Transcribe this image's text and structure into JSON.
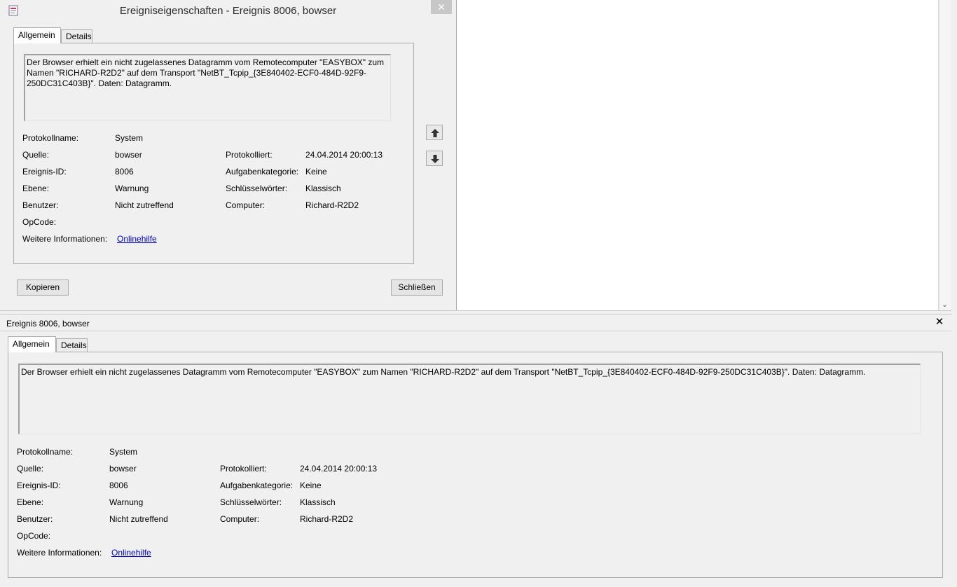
{
  "dialog": {
    "title": "Ereigniseigenschaften - Ereignis 8006, bowser",
    "close_glyph": "✕",
    "tabs": [
      "Allgemein",
      "Details"
    ],
    "message": "Der Browser erhielt ein nicht zugelassenes Datagramm vom Remotecomputer \"EASYBOX\" zum Namen \"RICHARD-R2D2\" auf dem Transport \"NetBT_Tcpip_{3E840402-ECF0-484D-92F9-250DC31C403B}\". Daten: Datagramm.",
    "buttons": {
      "copy": "Kopieren",
      "close": "Schließen"
    },
    "nav_icons": [
      "arrow-up-icon",
      "arrow-down-icon"
    ]
  },
  "fields": {
    "log_name_label": "Protokollname:",
    "log_name": "System",
    "source_label": "Quelle:",
    "source": "bowser",
    "logged_label": "Protokolliert:",
    "logged": "24.04.2014 20:00:13",
    "event_id_label": "Ereignis-ID:",
    "event_id": "8006",
    "task_category_label": "Aufgabenkategorie:",
    "task_category": "Keine",
    "level_label": "Ebene:",
    "level": "Warnung",
    "keywords_label": "Schlüsselwörter:",
    "keywords": "Klassisch",
    "user_label": "Benutzer:",
    "user": "Nicht zutreffend",
    "computer_label": "Computer:",
    "computer": "Richard-R2D2",
    "opcode_label": "OpCode:",
    "opcode": "",
    "more_info_label": "Weitere Informationen:",
    "more_info_link": "Onlinehilfe"
  },
  "preview": {
    "title": "Ereignis 8006, bowser",
    "close_glyph": "✕",
    "tabs": [
      "Allgemein",
      "Details"
    ],
    "message": "Der Browser erhielt ein nicht zugelassenes Datagramm vom Remotecomputer \"EASYBOX\" zum Namen \"RICHARD-R2D2\" auf dem Transport \"NetBT_Tcpip_{3E840402-ECF0-484D-92F9-250DC31C403B}\". Daten: Datagramm."
  },
  "background": {
    "scroll_down_glyph": "⌄"
  }
}
